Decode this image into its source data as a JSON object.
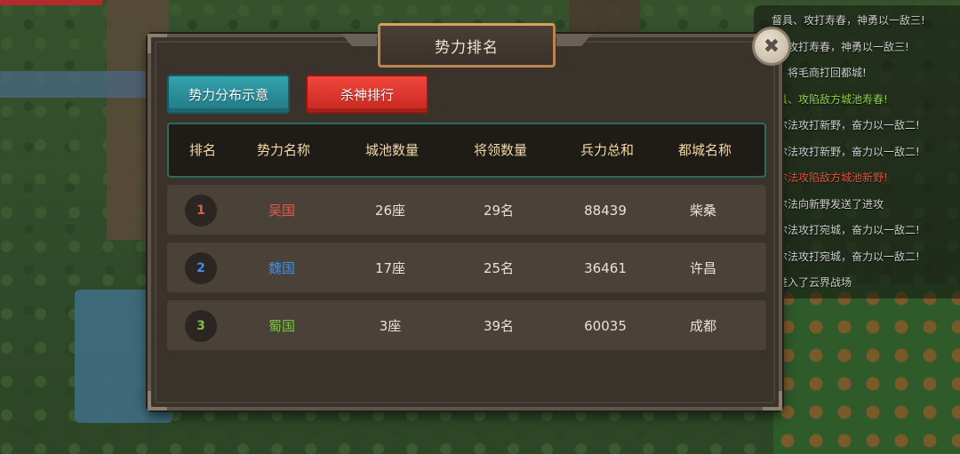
{
  "modal": {
    "title": "势力排名",
    "close_symbol": "✖",
    "tabs": [
      {
        "label": "势力分布示意",
        "color": "#2a8d98"
      },
      {
        "label": "杀神排行",
        "color": "#e2352c"
      }
    ],
    "table": {
      "headers": [
        "排名",
        "势力名称",
        "城池数量",
        "将领数量",
        "兵力总和",
        "都城名称"
      ],
      "rows": [
        {
          "rank": "1",
          "name": "吴国",
          "cities": "26座",
          "generals": "29名",
          "troops": "88439",
          "capital": "柴桑",
          "color": "#e05a48"
        },
        {
          "rank": "2",
          "name": "魏国",
          "cities": "17座",
          "generals": "25名",
          "troops": "36461",
          "capital": "许昌",
          "color": "#3f8fe0"
        },
        {
          "rank": "3",
          "name": "蜀国",
          "cities": "3座",
          "generals": "39名",
          "troops": "60035",
          "capital": "成都",
          "color": "#7ac142"
        }
      ]
    }
  },
  "chat": {
    "lines": [
      {
        "text": "督具、攻打寿春，神勇以一敌三!",
        "style": "normal"
      },
      {
        "text": "、攻打寿春，神勇以一敌三!",
        "style": "normal"
      },
      {
        "text": "、将毛商打回都城!",
        "style": "normal"
      },
      {
        "text": "具、攻陷敌方城池寿春!",
        "style": "green"
      },
      {
        "text": "尔法攻打新野，奋力以一敌二!",
        "style": "normal"
      },
      {
        "text": "尔法攻打新野，奋力以一敌二!",
        "style": "normal"
      },
      {
        "text": "尔法攻陷敌方城池新野!",
        "style": "red"
      },
      {
        "text": "尔法向新野发送了进攻",
        "style": "normal"
      },
      {
        "text": "尔法攻打宛城，奋力以一敌二!",
        "style": "normal"
      },
      {
        "text": "尔法攻打宛城，奋力以一敌二!",
        "style": "normal"
      },
      {
        "text": "进入了云界战场",
        "style": "normal"
      }
    ]
  }
}
